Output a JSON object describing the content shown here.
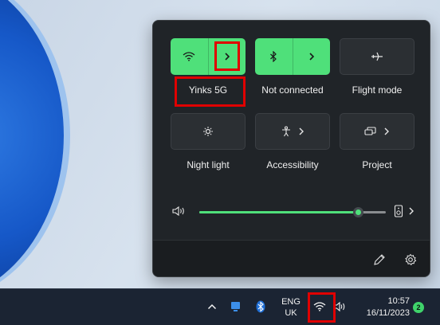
{
  "quick_settings": {
    "tiles": [
      {
        "label": "Yinks 5G",
        "state": "on",
        "icon": "wifi-icon",
        "expand_icon": "chevron-right-icon"
      },
      {
        "label": "Not connected",
        "state": "on",
        "icon": "bluetooth-icon",
        "expand_icon": "chevron-right-icon"
      },
      {
        "label": "Flight mode",
        "state": "off",
        "icon": "airplane-icon"
      },
      {
        "label": "Night light",
        "state": "off",
        "icon": "night-light-icon"
      },
      {
        "label": "Accessibility",
        "state": "off",
        "icon": "accessibility-icon",
        "expand_icon": "chevron-right-icon"
      },
      {
        "label": "Project",
        "state": "off",
        "icon": "project-icon",
        "expand_icon": "chevron-right-icon"
      }
    ],
    "volume": {
      "level_percent": 85,
      "icon": "speaker-icon",
      "output_icon": "audio-output-icon"
    },
    "footer": {
      "edit_icon": "pencil-icon",
      "settings_icon": "gear-icon"
    }
  },
  "taskbar": {
    "tray_icons": [
      "chevron-up-icon",
      "tray-app-icon",
      "bluetooth-icon"
    ],
    "language_line1": "ENG",
    "language_line2": "UK",
    "network_icon": "wifi-icon",
    "volume_icon": "speaker-icon",
    "time": "10:57",
    "date": "16/11/2023",
    "notification_count": "2"
  },
  "colors": {
    "accent": "#4fe07a",
    "panel": "#202428",
    "taskbar": "#1b2433",
    "highlight": "#e00000"
  }
}
